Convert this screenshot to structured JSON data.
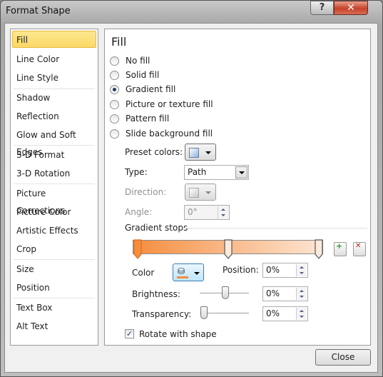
{
  "window": {
    "title": "Format Shape",
    "help_glyph": "?",
    "close_glyph": "✕"
  },
  "sidebar": {
    "items": [
      {
        "label": "Fill",
        "selected": true
      },
      {
        "label": "Line Color"
      },
      {
        "label": "Line Style"
      },
      {
        "label": "Shadow"
      },
      {
        "label": "Reflection"
      },
      {
        "label": "Glow and Soft Edges"
      },
      {
        "label": "3-D Format"
      },
      {
        "label": "3-D Rotation"
      },
      {
        "label": "Picture Corrections"
      },
      {
        "label": "Picture Color"
      },
      {
        "label": "Artistic Effects"
      },
      {
        "label": "Crop"
      },
      {
        "label": "Size"
      },
      {
        "label": "Position"
      },
      {
        "label": "Text Box"
      },
      {
        "label": "Alt Text"
      }
    ]
  },
  "fill": {
    "heading": "Fill",
    "options": [
      {
        "label": "No fill"
      },
      {
        "label": "Solid fill"
      },
      {
        "label": "Gradient fill",
        "selected": true
      },
      {
        "label": "Picture or texture fill"
      },
      {
        "label": "Pattern fill"
      },
      {
        "label": "Slide background fill"
      }
    ],
    "preset_colors_label": "Preset colors:",
    "type_label": "Type:",
    "type_value": "Path",
    "direction_label": "Direction:",
    "angle_label": "Angle:",
    "angle_value": "0°",
    "gradient_stops_label": "Gradient stops",
    "stops_percent": [
      0,
      50,
      100
    ],
    "gradient_colors": [
      "#f58d3f",
      "#fde5d3"
    ],
    "color_label": "Color",
    "stop_color": "#f58d3f",
    "position_label": "Position:",
    "position_value": "0%",
    "brightness_label": "Brightness:",
    "brightness_value": "0%",
    "brightness_level": 0,
    "transparency_label": "Transparency:",
    "transparency_value": "0%",
    "transparency_level": 0,
    "rotate_label": "Rotate with shape",
    "rotate_checked": true
  },
  "footer": {
    "close_label": "Close"
  }
}
